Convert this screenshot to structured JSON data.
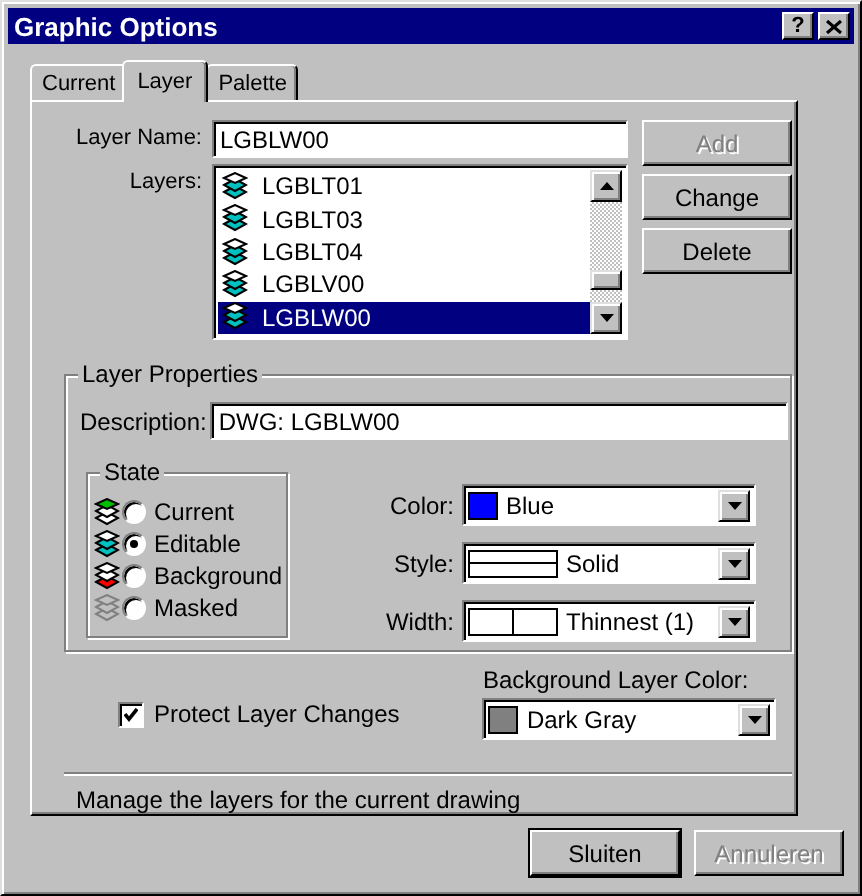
{
  "window": {
    "title": "Graphic Options",
    "help_button": "?"
  },
  "tabs": [
    {
      "label": "Current",
      "selected": false
    },
    {
      "label": "Layer",
      "selected": true
    },
    {
      "label": "Palette",
      "selected": false
    }
  ],
  "layer_name": {
    "label": "Layer Name:",
    "value": "LGBLW00"
  },
  "layers": {
    "label": "Layers:",
    "items": [
      {
        "name": "LGBLT01",
        "selected": false
      },
      {
        "name": "LGBLT03",
        "selected": false
      },
      {
        "name": "LGBLT04",
        "selected": false
      },
      {
        "name": "LGBLV00",
        "selected": false
      },
      {
        "name": "LGBLW00",
        "selected": true
      }
    ]
  },
  "side_buttons": [
    {
      "label": "Add",
      "disabled": true
    },
    {
      "label": "Change",
      "disabled": false
    },
    {
      "label": "Delete",
      "disabled": false
    }
  ],
  "layer_properties": {
    "title": "Layer Properties",
    "description": {
      "label": "Description:",
      "value": "DWG: LGBLW00"
    },
    "state": {
      "title": "State",
      "options": [
        {
          "label": "Current",
          "kind": "current",
          "selected": false
        },
        {
          "label": "Editable",
          "kind": "editable",
          "selected": true
        },
        {
          "label": "Background",
          "kind": "background",
          "selected": false
        },
        {
          "label": "Masked",
          "kind": "masked",
          "selected": false
        }
      ]
    },
    "combos": [
      {
        "label": "Color:",
        "kind": "swatch",
        "value": "Blue",
        "color": "#0000ff"
      },
      {
        "label": "Style:",
        "kind": "style",
        "value": "Solid"
      },
      {
        "label": "Width:",
        "kind": "width",
        "value": "Thinnest (1)"
      }
    ]
  },
  "protect": {
    "label": "Protect Layer Changes",
    "checked": true
  },
  "background_layer_color": {
    "label": "Background Layer Color:",
    "value": "Dark Gray",
    "color": "#808080"
  },
  "status": "Manage the layers for the current drawing",
  "footer_buttons": [
    {
      "label": "Sluiten",
      "disabled": false,
      "default": true
    },
    {
      "label": "Annuleren",
      "disabled": true,
      "default": false
    }
  ]
}
